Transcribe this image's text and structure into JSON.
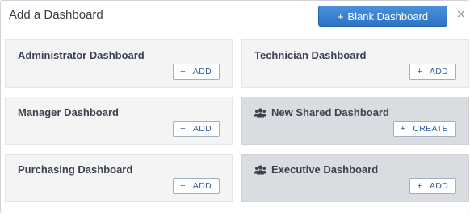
{
  "dialog": {
    "title": "Add a Dashboard",
    "blank_button_label": "Blank Dashboard",
    "close_glyph": "×"
  },
  "cards": [
    {
      "name": "Administrator Dashboard",
      "action": "ADD",
      "shared": false
    },
    {
      "name": "Technician Dashboard",
      "action": "ADD",
      "shared": false
    },
    {
      "name": "Manager Dashboard",
      "action": "ADD",
      "shared": false
    },
    {
      "name": "New Shared Dashboard",
      "action": "CREATE",
      "shared": true,
      "icon": "users-icon"
    },
    {
      "name": "Purchasing Dashboard",
      "action": "ADD",
      "shared": false
    },
    {
      "name": "Executive Dashboard",
      "action": "ADD",
      "shared": true,
      "icon": "users-icon"
    }
  ],
  "colors": {
    "primary_button": "#2c73c7",
    "shared_card_bg": "#d9dce0",
    "card_bg": "#f4f4f4"
  }
}
